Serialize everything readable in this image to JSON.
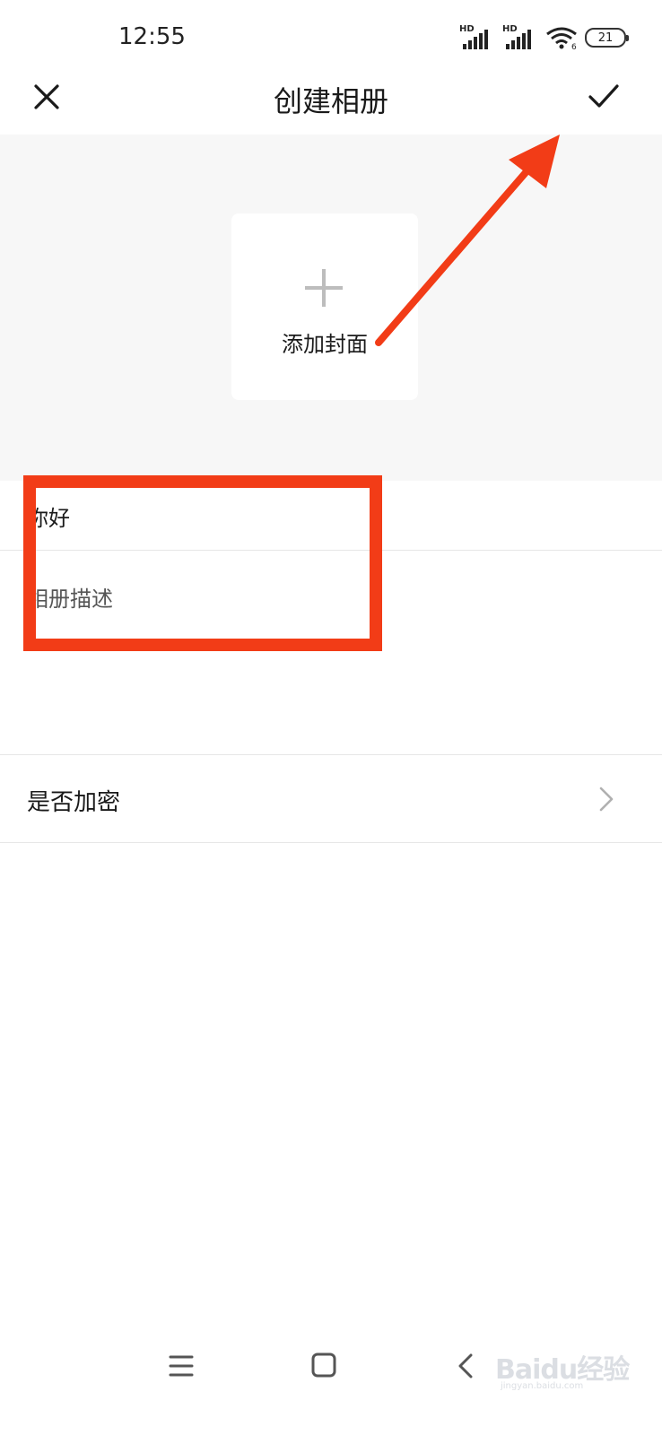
{
  "status_bar": {
    "time": "12:55",
    "signal_1_label": "HD",
    "signal_2_label": "HD",
    "wifi_label": "6",
    "battery": "21"
  },
  "header": {
    "title": "创建相册",
    "close_icon": "close-icon",
    "confirm_icon": "check-icon"
  },
  "cover": {
    "add_icon": "plus-icon",
    "label": "添加封面"
  },
  "form": {
    "name_value": "你好",
    "description_placeholder": "相册描述",
    "encrypt_label": "是否加密"
  },
  "system_nav": {
    "menu_icon": "menu-icon",
    "home_icon": "home-icon",
    "back_icon": "back-icon"
  },
  "watermark": {
    "brand": "Baidu经验",
    "site": "jingyan.baidu.com"
  },
  "colors": {
    "annotation": "#f23c17",
    "cover_background": "#f7f7f7",
    "divider": "#e6e6e6"
  }
}
